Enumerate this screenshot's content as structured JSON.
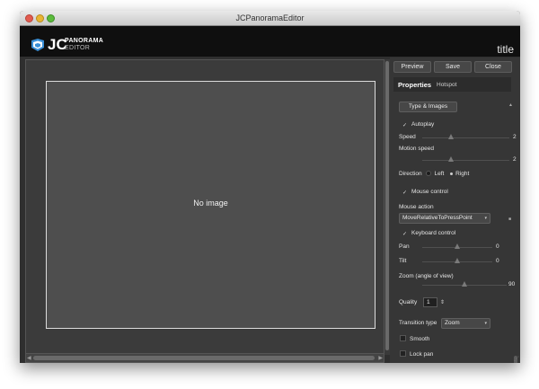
{
  "window": {
    "title": "JCPanoramaEditor"
  },
  "header": {
    "logo_jc": "JC",
    "logo_panorama": "PANORAMA",
    "logo_editor": "EDITOR",
    "title": "title"
  },
  "canvas": {
    "placeholder": "No image"
  },
  "toolbar": {
    "preview": "Preview",
    "save": "Save",
    "close": "Close"
  },
  "tabs": {
    "properties": "Properties",
    "hotspot": "Hotspot"
  },
  "props": {
    "type_images": "Type & Images",
    "autoplay": {
      "label": "Autoplay",
      "checked": true
    },
    "speed": {
      "label": "Speed",
      "value": "2",
      "slider_fraction": 0.33
    },
    "motion_speed": {
      "label": "Motion speed",
      "value": "2",
      "slider_fraction": 0.33
    },
    "direction": {
      "label": "Direction",
      "left": "Left",
      "right": "Right",
      "selected": "Right"
    },
    "mouse_control": {
      "label": "Mouse control",
      "checked": true
    },
    "mouse_action": {
      "label": "Mouse action",
      "value": "MoveRelativeToPressPoint"
    },
    "keyboard_control": {
      "label": "Keyboard control",
      "checked": true
    },
    "pan": {
      "label": "Pan",
      "value": "0",
      "slider_fraction": 0.5
    },
    "tilt": {
      "label": "Tilt",
      "value": "0",
      "slider_fraction": 0.5
    },
    "zoom": {
      "label": "Zoom (angle of view)",
      "value": "90",
      "slider_fraction": 0.5
    },
    "quality": {
      "label": "Quality",
      "value": "1"
    },
    "transition": {
      "label": "Transition type",
      "value": "Zoom"
    },
    "smooth": {
      "label": "Smooth",
      "checked": false
    },
    "lock_pan": {
      "label": "Lock pan",
      "checked": false
    }
  },
  "icons": {
    "check": "✓",
    "up_down": "⇕",
    "dropdown": "▾",
    "scroll_up": "▲",
    "scroll_left": "◀",
    "scroll_right": "▶",
    "resize": "⋰"
  },
  "colors": {
    "header_bg": "#0f0f0f",
    "panel_bg": "#363636",
    "canvas_bg": "#4e4e4e"
  }
}
